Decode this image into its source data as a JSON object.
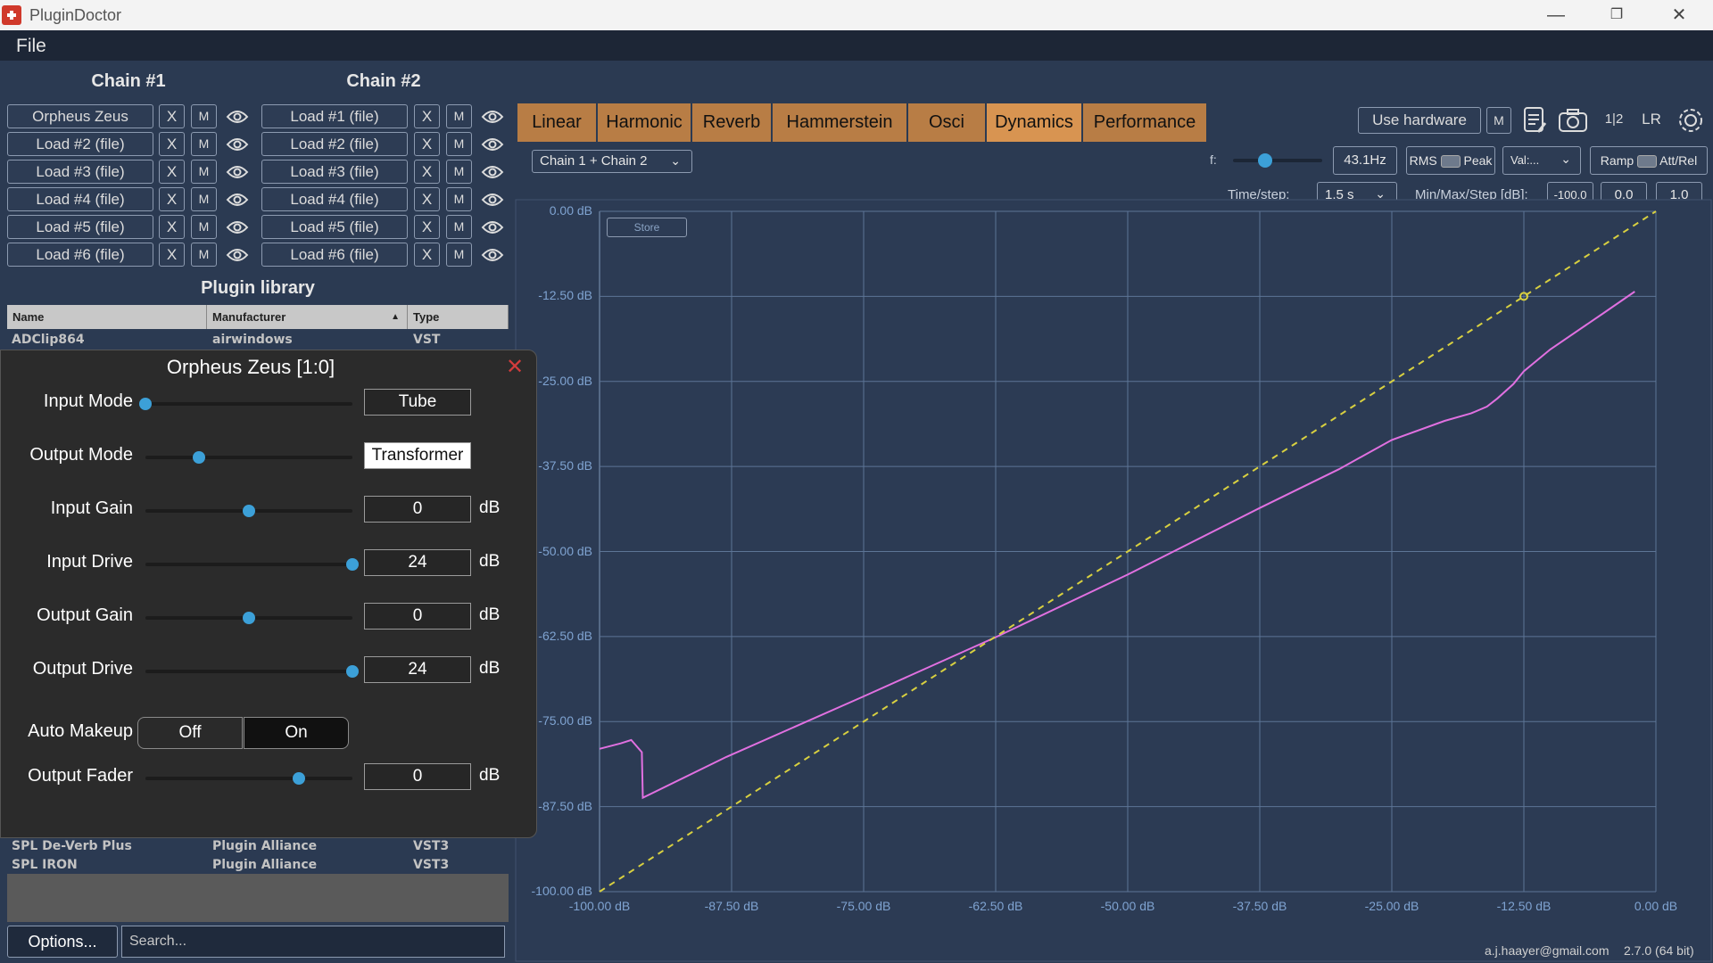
{
  "window": {
    "title": "PluginDoctor",
    "minimize_glyph": "—",
    "restore_glyph": "❐",
    "close_glyph": "✕"
  },
  "menu": {
    "file": "File"
  },
  "chain1": {
    "title": "Chain #1",
    "slots": [
      "Orpheus Zeus",
      "Load #2 (file)",
      "Load #3 (file)",
      "Load #4 (file)",
      "Load #5 (file)",
      "Load #6 (file)"
    ]
  },
  "chain2": {
    "title": "Chain #2",
    "slots": [
      "Load #1 (file)",
      "Load #2 (file)",
      "Load #3 (file)",
      "Load #4 (file)",
      "Load #5 (file)",
      "Load #6 (file)"
    ]
  },
  "slot_buttons": {
    "remove": "X",
    "mute": "M"
  },
  "library": {
    "title": "Plugin library",
    "columns": [
      "Name",
      "Manufacturer",
      "Type"
    ],
    "sort_indicator": "▲",
    "rows_top": [
      [
        "ADClip864",
        "airwindows",
        "VST"
      ]
    ],
    "rows_bottom": [
      [
        "SPL De-Verb Plus",
        "Plugin Alliance",
        "VST3"
      ],
      [
        "SPL IRON",
        "Plugin Alliance",
        "VST3"
      ]
    ],
    "options_label": "Options...",
    "search_placeholder": "Search..."
  },
  "plugin_window": {
    "title": "Orpheus Zeus [1:0]",
    "close_glyph": "✕",
    "params": [
      {
        "label": "Input Mode",
        "value": "Tube",
        "unit": "",
        "position": 0.0
      },
      {
        "label": "Output Mode",
        "value": "Transformer",
        "unit": "",
        "position": 0.26
      },
      {
        "label": "Input Gain",
        "value": "0",
        "unit": "dB",
        "position": 0.5
      },
      {
        "label": "Input Drive",
        "value": "24",
        "unit": "dB",
        "position": 1.0
      },
      {
        "label": "Output Gain",
        "value": "0",
        "unit": "dB",
        "position": 0.5
      },
      {
        "label": "Output Drive",
        "value": "24",
        "unit": "dB",
        "position": 1.0
      },
      {
        "label": "Output Fader",
        "value": "0",
        "unit": "dB",
        "position": 0.74
      }
    ],
    "auto_makeup": {
      "label": "Auto Makeup",
      "off": "Off",
      "on": "On",
      "selected": "On"
    }
  },
  "tabs": [
    "Linear",
    "Harmonic",
    "Reverb",
    "Hammerstein",
    "Osci",
    "Dynamics",
    "Performance"
  ],
  "active_tab": "Dynamics",
  "toolbar": {
    "use_hardware": "Use hardware",
    "mute": "M",
    "split": "1|2",
    "lr": "LR",
    "icons": [
      "notes-icon",
      "camera-icon",
      "settings-icon"
    ]
  },
  "analysis": {
    "chain_select": "Chain 1 + Chain 2",
    "f_label": "f:",
    "f_value": "43.1Hz",
    "rms": "RMS",
    "peak": "Peak",
    "val_select": "Val:...",
    "ramp": "Ramp",
    "att_rel": "Att/Rel",
    "time_step_label": "Time/step:",
    "time_step_value": "1.5 s",
    "minmaxstep_label": "Min/Max/Step [dB]:",
    "min": "-100.0",
    "max": "0.0",
    "step": "1.0",
    "store": "Store"
  },
  "chart_data": {
    "type": "line",
    "xlabel": "",
    "ylabel": "",
    "xlim": [
      -100,
      0
    ],
    "ylim": [
      -100,
      0
    ],
    "x_ticks": [
      "-100.00 dB",
      "-87.50 dB",
      "-75.00 dB",
      "-62.50 dB",
      "-50.00 dB",
      "-37.50 dB",
      "-25.00 dB",
      "-12.50 dB",
      "0.00 dB"
    ],
    "y_ticks": [
      "0.00 dB",
      "-12.50 dB",
      "-25.00 dB",
      "-37.50 dB",
      "-50.00 dB",
      "-62.50 dB",
      "-75.00 dB",
      "-87.50 dB",
      "-100.00 dB"
    ],
    "grid": true,
    "colors": {
      "response": "#e070e0",
      "reference": "#d8d040"
    },
    "series": [
      {
        "style": "solid",
        "x": [
          -100,
          -98,
          -97,
          -96,
          -95.9,
          -88,
          -75,
          -62.5,
          -50,
          -37.5,
          -30,
          -25,
          -20,
          -17.5,
          -16,
          -15,
          -13.5,
          -12.5,
          -10,
          -5,
          -2
        ],
        "y": [
          -79,
          -78.2,
          -77.7,
          -79.5,
          -86.2,
          -80.2,
          -71.3,
          -62.6,
          -53.4,
          -43.6,
          -37.9,
          -33.6,
          -30.8,
          -29.7,
          -28.7,
          -27.5,
          -25.4,
          -23.5,
          -20.3,
          -15.0,
          -11.8
        ]
      },
      {
        "style": "dashed",
        "x": [
          -100,
          0
        ],
        "y": [
          -100,
          0
        ]
      }
    ],
    "marker": {
      "x": -12.5,
      "y": -12.5
    }
  },
  "footer": {
    "email": "a.j.haayer@gmail.com",
    "version": "2.7.0 (64 bit)"
  }
}
